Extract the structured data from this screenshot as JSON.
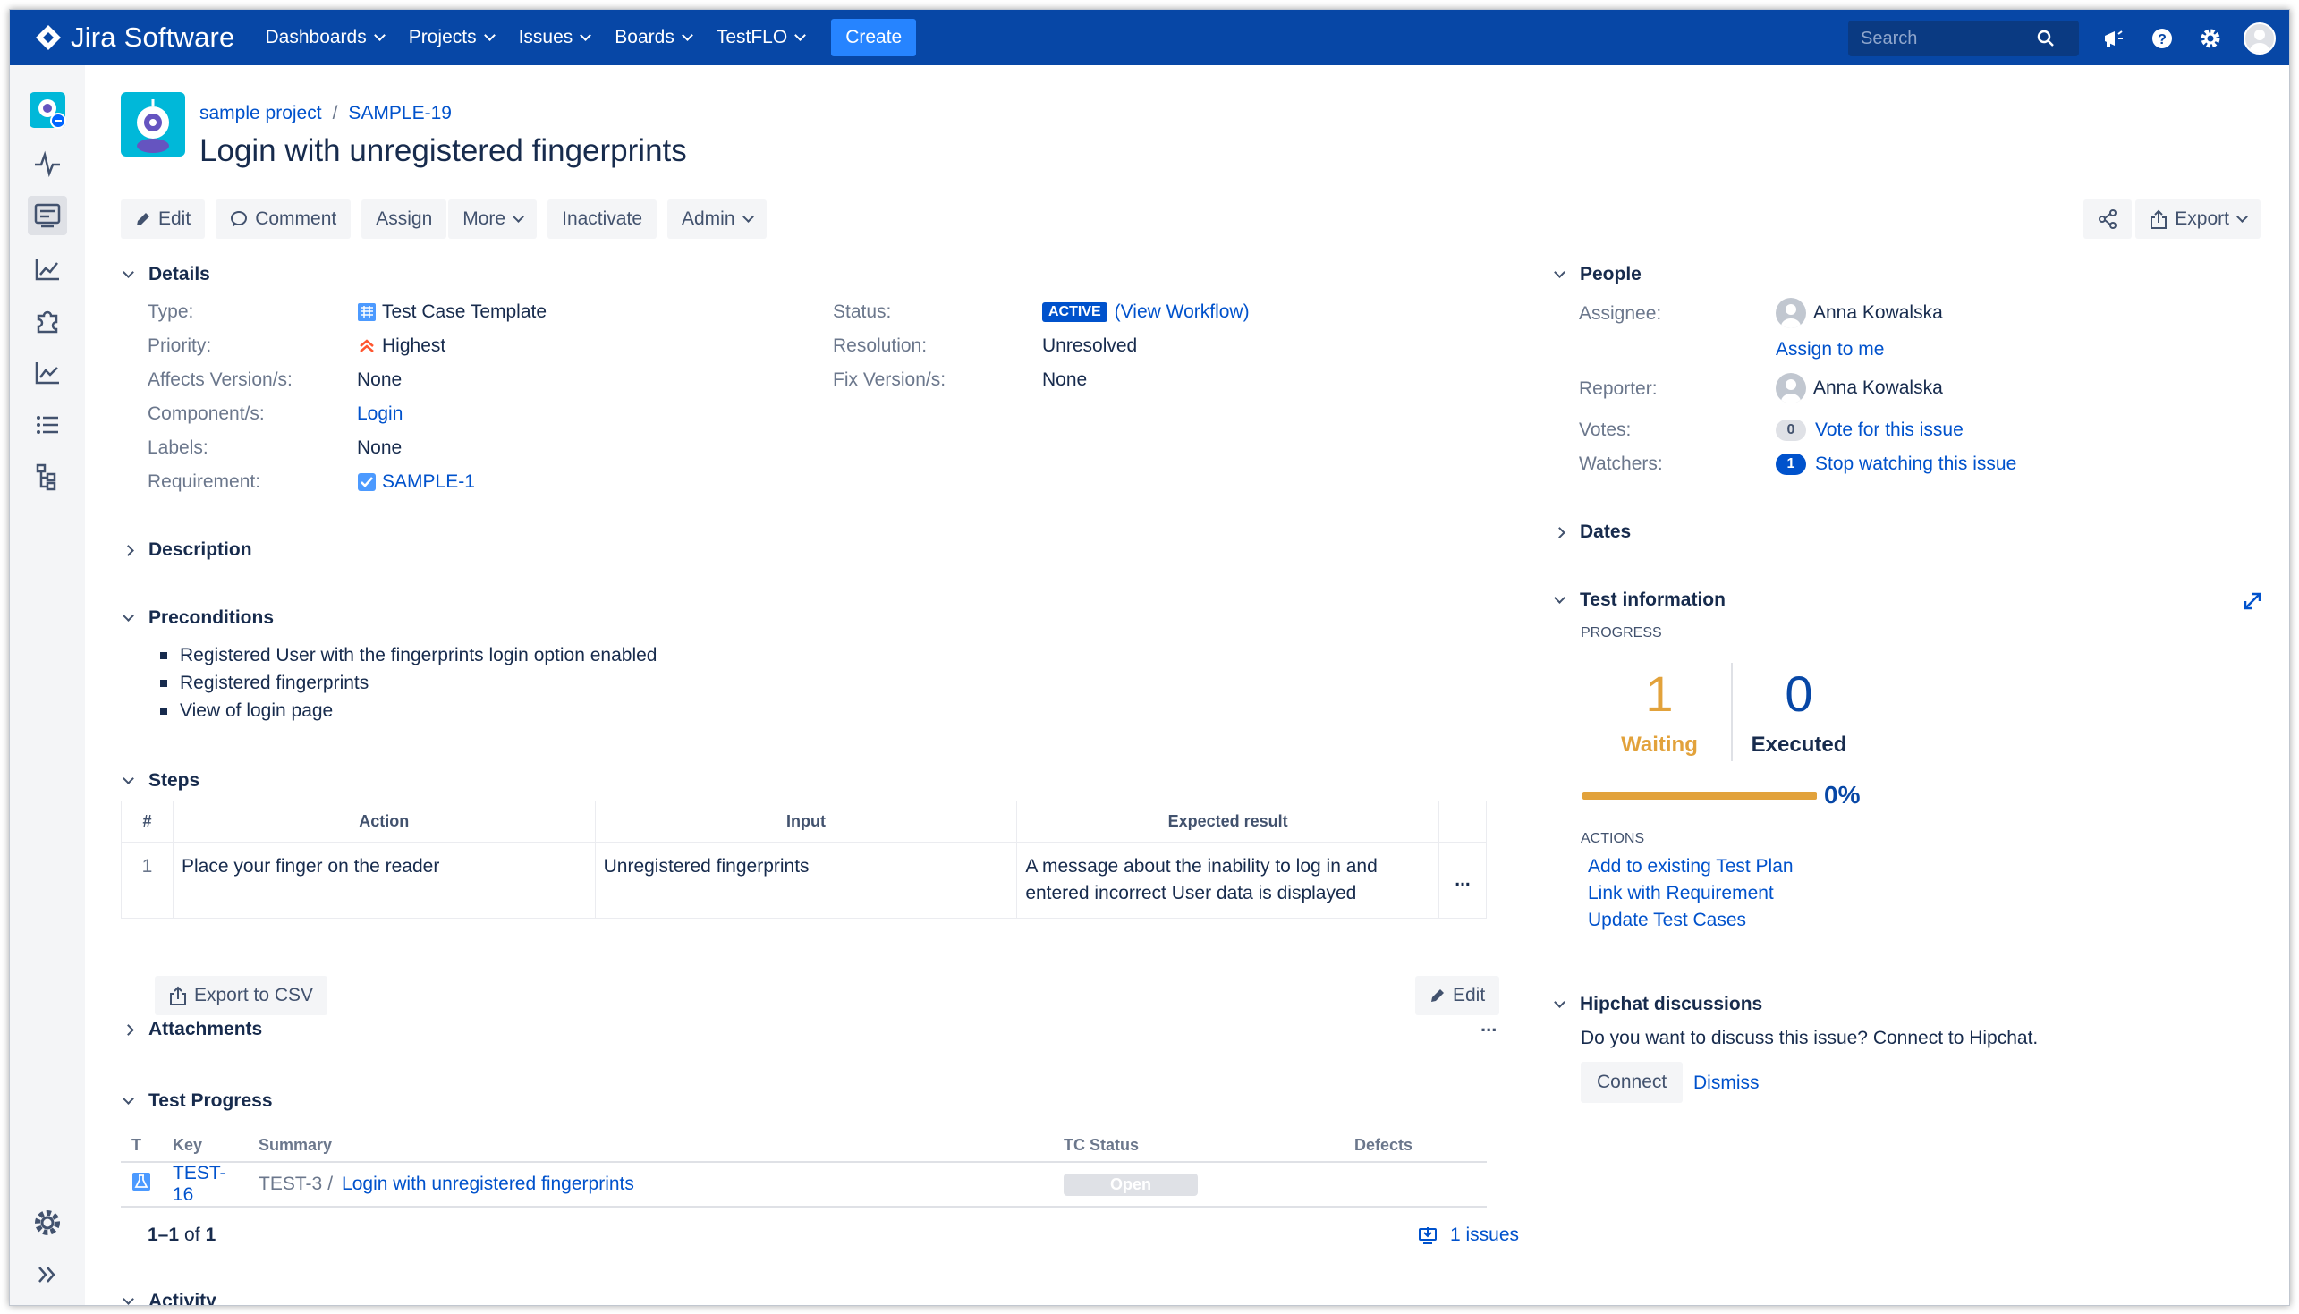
{
  "topnav": {
    "brand": "Jira Software",
    "items": [
      {
        "label": "Dashboards"
      },
      {
        "label": "Projects"
      },
      {
        "label": "Issues"
      },
      {
        "label": "Boards"
      },
      {
        "label": "TestFLO"
      }
    ],
    "create_label": "Create",
    "search_placeholder": "Search"
  },
  "breadcrumb": {
    "project": "sample project",
    "issue_key": "SAMPLE-19"
  },
  "issue": {
    "title": "Login with unregistered fingerprints"
  },
  "toolbar": {
    "edit": "Edit",
    "comment": "Comment",
    "assign": "Assign",
    "more": "More",
    "inactivate": "Inactivate",
    "admin": "Admin",
    "export": "Export"
  },
  "details": {
    "heading": "Details",
    "left": [
      {
        "label": "Type:",
        "value": "Test Case Template"
      },
      {
        "label": "Priority:",
        "value": "Highest"
      },
      {
        "label": "Affects Version/s:",
        "value": "None"
      },
      {
        "label": "Component/s:",
        "value": "Login"
      },
      {
        "label": "Labels:",
        "value": "None"
      },
      {
        "label": "Requirement:",
        "value": "SAMPLE-1"
      }
    ],
    "right": [
      {
        "label": "Status:",
        "lozenge": "ACTIVE",
        "value": "(View Workflow)"
      },
      {
        "label": "Resolution:",
        "value": "Unresolved"
      },
      {
        "label": "Fix Version/s:",
        "value": "None"
      }
    ]
  },
  "description": {
    "heading": "Description"
  },
  "preconditions": {
    "heading": "Preconditions",
    "items": [
      "Registered User with the fingerprints login option enabled",
      "Registered fingerprints",
      "View of login page"
    ]
  },
  "steps": {
    "heading": "Steps",
    "columns": [
      "#",
      "Action",
      "Input",
      "Expected result"
    ],
    "rows": [
      {
        "num": "1",
        "action": "Place your finger on the reader",
        "input": "Unregistered fingerprints",
        "expected": "A message about the inability to log in and entered incorrect User data is displayed"
      }
    ],
    "more": "...",
    "export_csv": "Export to CSV",
    "edit": "Edit"
  },
  "attachments": {
    "heading": "Attachments",
    "more": "..."
  },
  "test_progress": {
    "heading": "Test Progress",
    "columns": [
      "T",
      "Key",
      "Summary",
      "TC Status",
      "Defects"
    ],
    "rows": [
      {
        "key": "TEST-16",
        "parent": "TEST-3",
        "summary": "Login with unregistered fingerprints",
        "status": "Open",
        "defects": ""
      }
    ],
    "paging_range": "1–1",
    "paging_of": "of",
    "paging_total": "1",
    "issues_link": "1 issues"
  },
  "activity": {
    "heading": "Activity"
  },
  "people": {
    "heading": "People",
    "assignee_label": "Assignee:",
    "assignee": "Anna Kowalska",
    "assign_to_me": "Assign to me",
    "reporter_label": "Reporter:",
    "reporter": "Anna Kowalska",
    "votes_label": "Votes:",
    "votes_count": "0",
    "vote_link": "Vote for this issue",
    "watchers_label": "Watchers:",
    "watchers_count": "1",
    "watch_link": "Stop watching this issue"
  },
  "dates": {
    "heading": "Dates"
  },
  "test_information": {
    "heading": "Test information",
    "progress_label": "PROGRESS",
    "waiting_count": "1",
    "waiting_label": "Waiting",
    "executed_count": "0",
    "executed_label": "Executed",
    "percent": "0%",
    "progress_fraction": 0,
    "actions_label": "ACTIONS",
    "actions": [
      "Add to existing Test Plan",
      "Link with Requirement",
      "Update Test Cases"
    ]
  },
  "hipchat": {
    "heading": "Hipchat discussions",
    "text": "Do you want to discuss this issue? Connect to Hipchat.",
    "connect": "Connect",
    "dismiss": "Dismiss"
  },
  "colors": {
    "nav": "#0747a6",
    "link": "#0052cc",
    "waiting": "#e2a23b",
    "executed": "#0747a6",
    "create": "#2684ff"
  }
}
